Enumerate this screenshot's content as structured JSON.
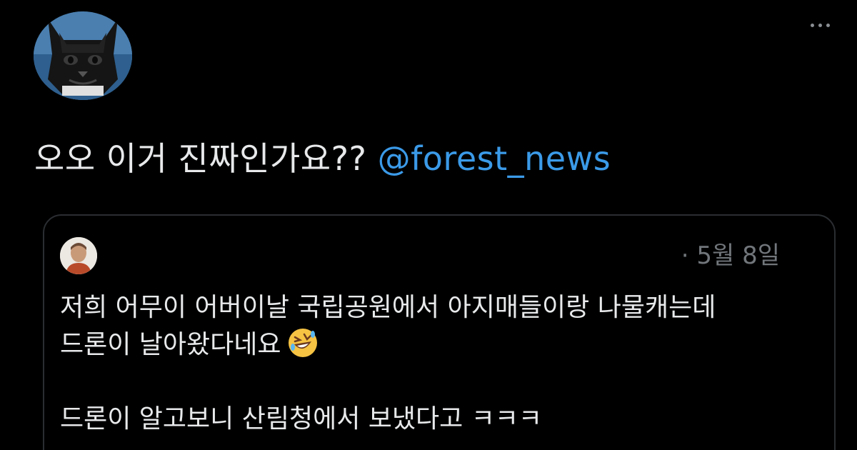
{
  "tweet": {
    "author_avatar_icon": "cat-avatar-icon",
    "more_icon": "more-options-icon",
    "text": "오오 이거 진짜인가요??",
    "mention": "@forest_news"
  },
  "quoted_tweet": {
    "avatar_icon": "person-avatar-icon",
    "date": "· 5월 8일",
    "lines": [
      "저희 어무이 어버이날 국립공원에서 아지매들이랑 나물캐는데",
      "드론이 날아왔다네요",
      "드론이 알고보니 산림청에서 보냈다고 ㅋㅋㅋ"
    ],
    "emoji_icon": "rolling-on-floor-laughing-emoji"
  },
  "colors": {
    "background": "#000000",
    "text": "#e7e9ea",
    "mention": "#3b9ae8",
    "muted": "#71767b",
    "border": "#2a2d31"
  }
}
